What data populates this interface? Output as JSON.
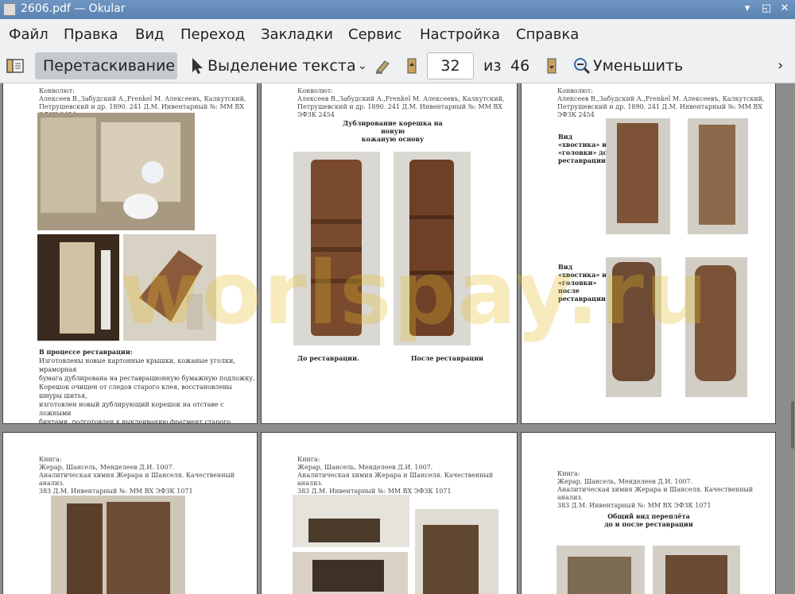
{
  "window": {
    "title": "2606.pdf  — Okular"
  },
  "menu": [
    "Файл",
    "Правка",
    "Вид",
    "Переход",
    "Закладки",
    "Сервис",
    "Настройка",
    "Справка"
  ],
  "toolbar": {
    "drag_label": "Перетаскивание",
    "select_label": "Выделение текста",
    "page_current": "32",
    "of_label": "из",
    "page_total": "46",
    "zoom_out_label": "Уменьшить"
  },
  "watermark": "worlspay.ru",
  "colors": {
    "accent": "#5a82b0",
    "toolbar": "#eff0f1",
    "viewport": "#8d8d8d"
  },
  "pages": {
    "p1": {
      "header": "Конволют:\n  Алексеев В.,Забудский А.,Frenkel M. Алексеевъ, Калкутский,\nПетрушевский и др. 1890.  241 Д.М. Инвентарный №: ММ ВХ ЭФЗК 2454",
      "caption": "В процессе реставрации:",
      "body": "Изготовлены новые картонные крышки, кожаные уголки, мраморная\nбумага дублирована на реставрационную бумажную подложку.\nКорешок  очищен от следов старого клея, восстановлены шнуры шитья,\n изготовлен новый дублирующий корешок на отставе с ложными\nбинтами, подготовлен  к выклеиванию фрагмент старого корешка."
    },
    "p2": {
      "header": "Конволют:\n  Алексеев В.,Забудский А.,Frenkel M. Алексеевъ, Калкутский,\nПетрушевский и др. 1890.  241 Д.М. Инвентарный №: ММ ВХ ЭФЗК 2454",
      "title": "Дублирование корешка на новую\nкожаную основу",
      "before": "До реставрации.",
      "after": "После реставрации"
    },
    "p3": {
      "header": "Конволют:\n  Алексеев В.,Забудский А.,Frenkel M. Алексеевъ, Калкутский,\nПетрушевский и др. 1890.  241 Д.М. Инвентарный №: ММ ВХ ЭФЗК 2454",
      "cap_before": "Вид\n«хвостика» и\n«головки» до\nреставрации",
      "cap_after": "Вид\n«хвостика» и\n«головки»\nпосле\nреставрации"
    },
    "p4": {
      "header": "Книга:\n Жерар, Шансель, Менделеев Д.И. 1007.\nАналитическая химия Жерара и Шанселя. Качественный анализ.\n383 Д.М.  Инвентарный №: ММ ВХ ЭФЗК 1071"
    },
    "p5": {
      "header": "Книга:\n Жерар, Шансель, Менделеев Д.И. 1007.\nАналитическая химия Жерара и Шанселя. Качественный анализ.\n383 Д.М.  Инвентарный №: ММ ВХ ЭФЗК 1071"
    },
    "p6": {
      "header": "Книга:\n Жерар, Шансель, Менделеев Д.И. 1007.\nАналитическая химия Жерара и Шанселя. Качественный анализ.\n383 Д.М.  Инвентарный №: ММ ВХ ЭФЗК 1071",
      "title": "Общий вид переплёта\nдо и после реставрации"
    }
  }
}
